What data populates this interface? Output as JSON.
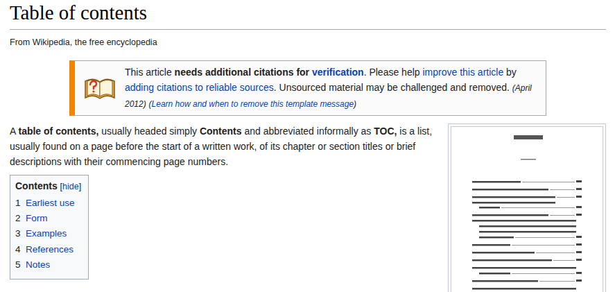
{
  "article": {
    "title": "Table of contents",
    "tagline": "From Wikipedia, the free encyclopedia"
  },
  "notice": {
    "segments": [
      {
        "text": "This article ",
        "kind": "plain"
      },
      {
        "text": "needs additional citations for ",
        "kind": "bold"
      },
      {
        "text": "verification",
        "kind": "bold-link"
      },
      {
        "text": ". Please help ",
        "kind": "plain"
      },
      {
        "text": "improve this article",
        "kind": "link"
      },
      {
        "text": " by ",
        "kind": "plain"
      },
      {
        "text": "adding citations to reliable sources",
        "kind": "link"
      },
      {
        "text": ". Unsourced material may be challenged and removed. ",
        "kind": "plain"
      },
      {
        "text": "(April 2012)",
        "kind": "small-italic"
      },
      {
        "text": " ",
        "kind": "plain"
      },
      {
        "text": "(",
        "kind": "small-italic"
      },
      {
        "text": "Learn how and when to remove this template message",
        "kind": "small-italic-link"
      },
      {
        "text": ")",
        "kind": "small-italic"
      }
    ]
  },
  "intro": {
    "segments": [
      {
        "text": "A ",
        "kind": "plain"
      },
      {
        "text": "table of contents,",
        "kind": "bold"
      },
      {
        "text": " usually headed simply ",
        "kind": "plain"
      },
      {
        "text": "Contents",
        "kind": "bold"
      },
      {
        "text": " and abbreviated informally as ",
        "kind": "plain"
      },
      {
        "text": "TOC,",
        "kind": "bold"
      },
      {
        "text": " is a list, usually found on a page before the start of a written work, of its chapter or section titles or brief descriptions with their commencing page numbers.",
        "kind": "plain"
      }
    ]
  },
  "toc": {
    "title": "Contents",
    "toggle_open": "[",
    "toggle": "hide",
    "toggle_close": "]",
    "items": [
      {
        "number": "1",
        "label": "Earliest use"
      },
      {
        "number": "2",
        "label": "Form"
      },
      {
        "number": "3",
        "label": "Examples"
      },
      {
        "number": "4",
        "label": "References"
      },
      {
        "number": "5",
        "label": "Notes"
      }
    ]
  }
}
